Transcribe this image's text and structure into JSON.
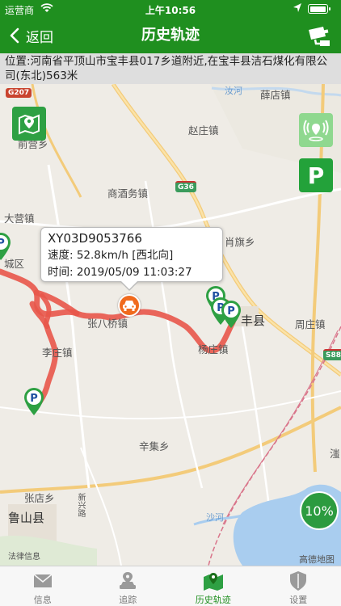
{
  "status_bar": {
    "carrier": "运营商",
    "time": "上午10:56"
  },
  "nav": {
    "back_label": "返回",
    "title": "历史轨迹"
  },
  "address": {
    "text": "位置:河南省平顶山市宝丰县017乡道附近,在宝丰县洁石煤化有限公司(东北)563米"
  },
  "map": {
    "places": {
      "xue_dian": "薛店镇",
      "zhao_zhuang": "赵庄镇",
      "qian_ying": "前营乡",
      "shang_jiu_wu": "商酒务镇",
      "da_ying": "大营镇",
      "xiao_qi": "肖旗乡",
      "zhang_ba_qiao": "张八桥镇",
      "yang_zhuang": "杨庄镇",
      "bao_feng": "丰县",
      "zhou_zhuang": "周庄镇",
      "li_zhuang": "李庄镇",
      "xin_cheng": "城区",
      "xin_ji": "辛集乡",
      "zhang_dian": "张店乡",
      "lu_shan": "鲁山县",
      "shi_he": "沙河",
      "ru_he": "汝河",
      "xing_xing": "滍",
      "xin_xing_road": "新兴路",
      "fa_lv": "法律信息",
      "gaode": "高德地图"
    },
    "road_badges": {
      "g207": "G207",
      "g36": "G36",
      "s88": "S88"
    },
    "parking_label": "P",
    "zoom_level": "10%"
  },
  "popup": {
    "plate": "XY03D9053766",
    "speed": "速度: 52.8km/h [西北向]",
    "time": "时间: 2019/05/09 11:03:27"
  },
  "tabs": [
    {
      "label": "信息",
      "icon": "mail-icon"
    },
    {
      "label": "追踪",
      "icon": "car-location-icon"
    },
    {
      "label": "历史轨迹",
      "icon": "map-pin-icon",
      "active": true
    },
    {
      "label": "设置",
      "icon": "shield-icon"
    }
  ],
  "colors": {
    "primary": "#1f8f1f",
    "track": "#e8574a",
    "vehicle": "#f06a1d"
  }
}
